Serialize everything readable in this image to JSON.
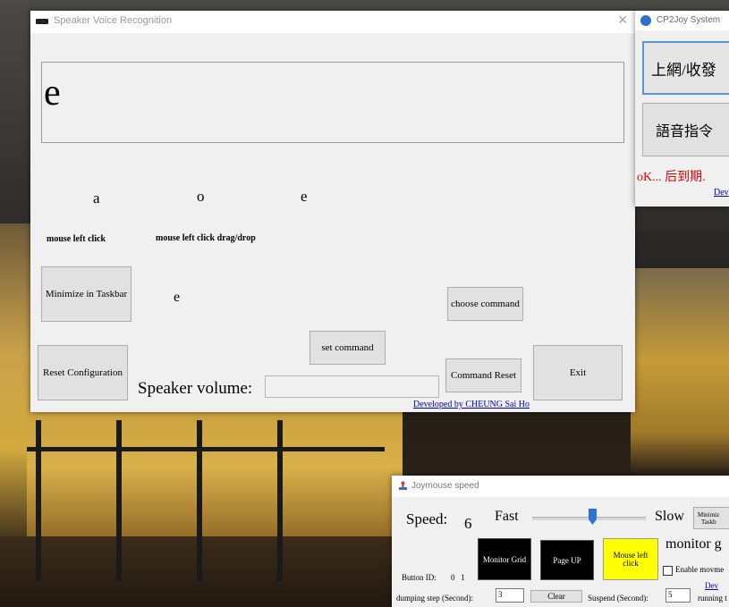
{
  "main_window": {
    "title": "Speaker Voice Recognition",
    "recognized_text": "e",
    "commands": [
      "a",
      "o",
      "e"
    ],
    "action_labels": [
      "mouse left click",
      "mouse left click drag/drop"
    ],
    "current_letter": "e",
    "buttons": {
      "minimize": "Minimize in Taskbar",
      "choose_command": "choose command",
      "set_command": "set command",
      "reset_configuration": "Reset Configuration",
      "command_reset": "Command Reset",
      "exit": "Exit"
    },
    "speaker_volume_label": "Speaker volume:",
    "developer_link": "Developed by CHEUNG Sai Ho"
  },
  "right_window": {
    "title": "CP2Joy System",
    "button1": "上網/收發",
    "button2": "語音指令",
    "status_text": "oK... 后到期.",
    "link": "Dev"
  },
  "joymouse_window": {
    "title": "Joymouse speed",
    "speed_label": "Speed:",
    "speed_value": "6",
    "fast_label": "Fast",
    "slow_label": "Slow",
    "speed_slider_fraction": 0.53,
    "minimize_label_1": "Minimiz",
    "minimize_label_2": "Taskb",
    "monitor_btn": "Monitor Grid",
    "pageup_btn": "Page UP",
    "mouse_left_btn": "Mouse left click",
    "monitor_text": "monitor g",
    "button_id_label": "Button ID:",
    "button_id_values": "0   1",
    "enable_label": "Enable movme",
    "dev_link": "Dev",
    "dumping_label": "dumping step (Second):",
    "dumping_value": "3",
    "clear_btn": "Clear",
    "suspend_label": "Suspend (Second):",
    "suspend_value": "5",
    "running_label": "running t"
  },
  "colors": {
    "mouse_left_bg": "#ffff00",
    "status_red": "#e00000",
    "link_blue": "#0000cc"
  }
}
